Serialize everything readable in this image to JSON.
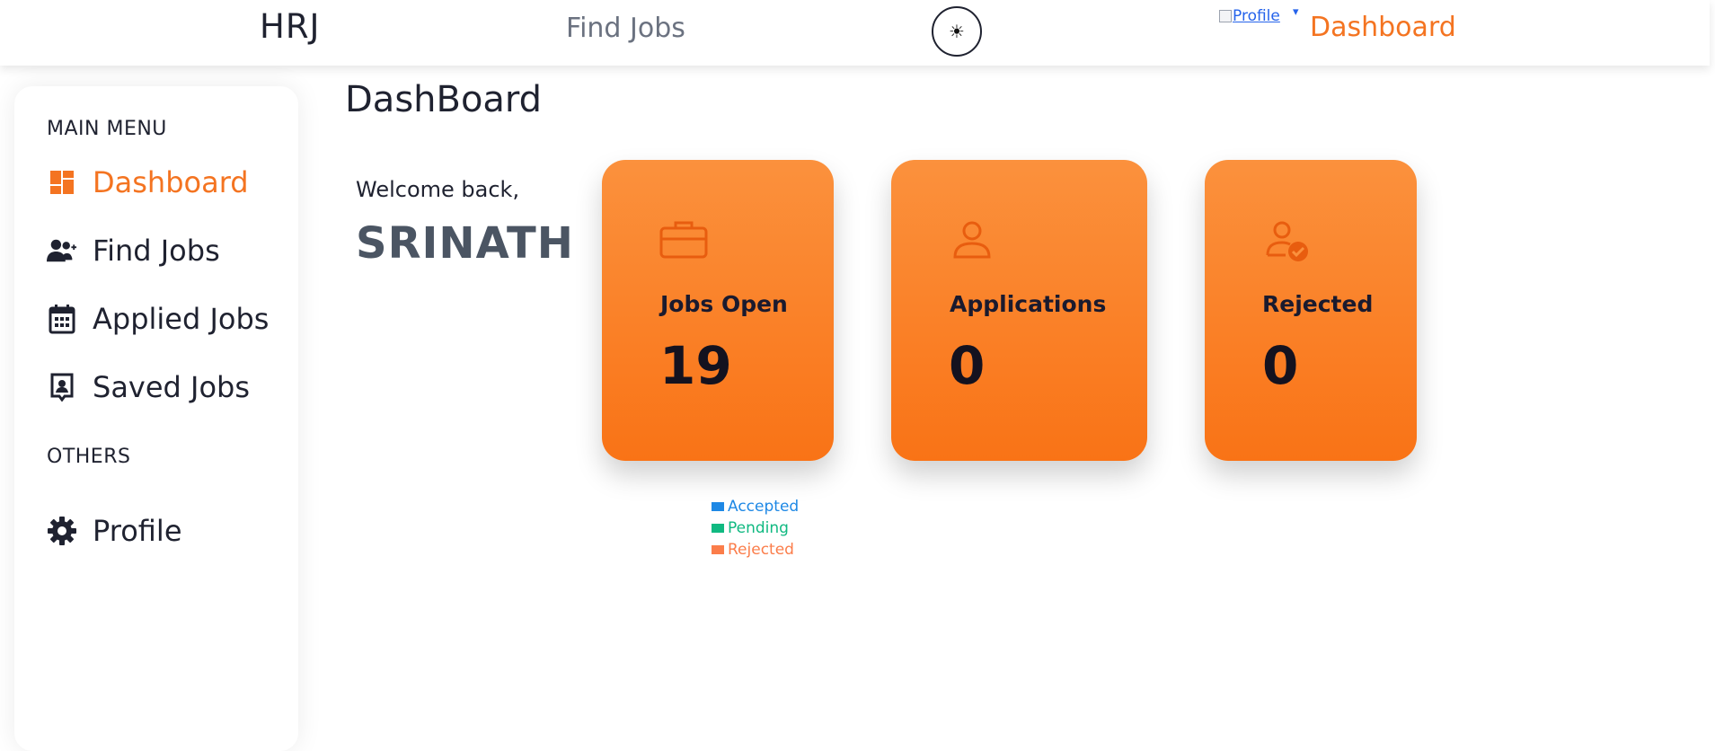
{
  "navbar": {
    "brand": "HRJ",
    "find_jobs": "Find Jobs",
    "theme_toggle_icon": "sun-icon",
    "profile_alt": "Profile",
    "dashboard": "Dashboard"
  },
  "sidebar": {
    "main_menu_title": "MAIN MENU",
    "items": [
      {
        "label": "Dashboard",
        "icon": "dashboard-icon",
        "active": true
      },
      {
        "label": "Find Jobs",
        "icon": "user-plus-icon",
        "active": false
      },
      {
        "label": "Applied Jobs",
        "icon": "calendar-icon",
        "active": false
      },
      {
        "label": "Saved Jobs",
        "icon": "id-badge-icon",
        "active": false
      }
    ],
    "others_title": "OTHERS",
    "others_items": [
      {
        "label": "Profile",
        "icon": "gear-icon"
      }
    ]
  },
  "main": {
    "page_title": "DashBoard",
    "welcome": "Welcome back,",
    "username": "SRINATH",
    "cards": [
      {
        "label": "Jobs Open",
        "value": "19",
        "icon": "briefcase-icon"
      },
      {
        "label": "Applications",
        "value": "0",
        "icon": "user-icon"
      },
      {
        "label": "Rejected",
        "value": "0",
        "icon": "user-check-icon"
      }
    ],
    "legend": [
      {
        "label": "Accepted",
        "color": "#1e88e5"
      },
      {
        "label": "Pending",
        "color": "#10b981"
      },
      {
        "label": "Rejected",
        "color": "#fb7d4a"
      }
    ]
  },
  "colors": {
    "accent": "#f47421",
    "card_gradient_top": "#fb913d",
    "card_gradient_bottom": "#f97316"
  }
}
